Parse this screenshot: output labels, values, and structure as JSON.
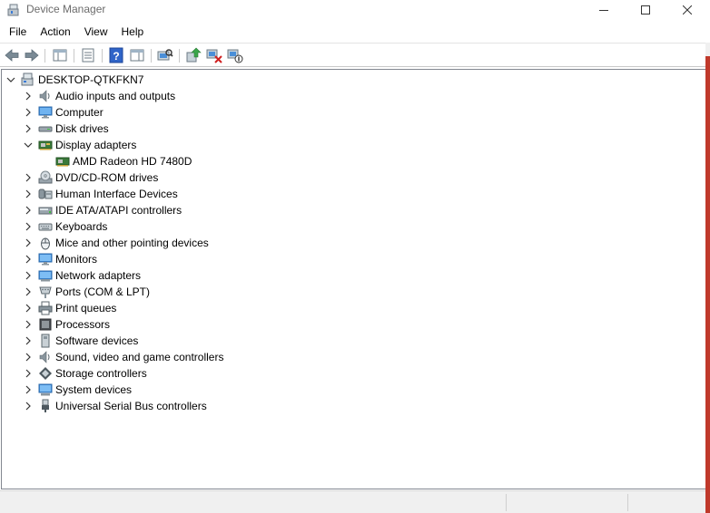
{
  "window": {
    "title": "Device Manager"
  },
  "menu": [
    "File",
    "Action",
    "View",
    "Help"
  ],
  "toolbar_icons": [
    "back-icon",
    "forward-icon",
    "console-tree-icon",
    "properties-icon",
    "help-icon",
    "action-pane-icon",
    "scan-hardware-icon",
    "update-driver-icon",
    "uninstall-device-icon",
    "disable-device-icon"
  ],
  "tree": {
    "root": "DESKTOP-QTKFKN7",
    "items": [
      {
        "label": "Audio inputs and outputs",
        "icon": "speaker-icon",
        "expanded": false,
        "children": []
      },
      {
        "label": "Computer",
        "icon": "computer-icon",
        "expanded": false,
        "children": []
      },
      {
        "label": "Disk drives",
        "icon": "disk-drive-icon",
        "expanded": false,
        "children": []
      },
      {
        "label": "Display adapters",
        "icon": "display-adapter-icon",
        "expanded": true,
        "children": [
          "AMD Radeon HD 7480D"
        ]
      },
      {
        "label": "DVD/CD-ROM drives",
        "icon": "dvd-drive-icon",
        "expanded": false,
        "children": []
      },
      {
        "label": "Human Interface Devices",
        "icon": "hid-icon",
        "expanded": false,
        "children": []
      },
      {
        "label": "IDE ATA/ATAPI controllers",
        "icon": "ide-controller-icon",
        "expanded": false,
        "children": []
      },
      {
        "label": "Keyboards",
        "icon": "keyboard-icon",
        "expanded": false,
        "children": []
      },
      {
        "label": "Mice and other pointing devices",
        "icon": "mouse-icon",
        "expanded": false,
        "children": []
      },
      {
        "label": "Monitors",
        "icon": "monitor-icon",
        "expanded": false,
        "children": []
      },
      {
        "label": "Network adapters",
        "icon": "network-adapter-icon",
        "expanded": false,
        "children": []
      },
      {
        "label": "Ports (COM & LPT)",
        "icon": "port-icon",
        "expanded": false,
        "children": []
      },
      {
        "label": "Print queues",
        "icon": "printer-icon",
        "expanded": false,
        "children": []
      },
      {
        "label": "Processors",
        "icon": "processor-icon",
        "expanded": false,
        "children": []
      },
      {
        "label": "Software devices",
        "icon": "software-device-icon",
        "expanded": false,
        "children": []
      },
      {
        "label": "Sound, video and game controllers",
        "icon": "sound-controller-icon",
        "expanded": false,
        "children": []
      },
      {
        "label": "Storage controllers",
        "icon": "storage-controller-icon",
        "expanded": false,
        "children": []
      },
      {
        "label": "System devices",
        "icon": "system-devices-icon",
        "expanded": false,
        "children": []
      },
      {
        "label": "Universal Serial Bus controllers",
        "icon": "usb-icon",
        "expanded": false,
        "children": []
      }
    ]
  },
  "colors": {
    "accent_red": "#c0392b",
    "tree_border": "#828790",
    "status_bg": "#f0f0f0"
  }
}
